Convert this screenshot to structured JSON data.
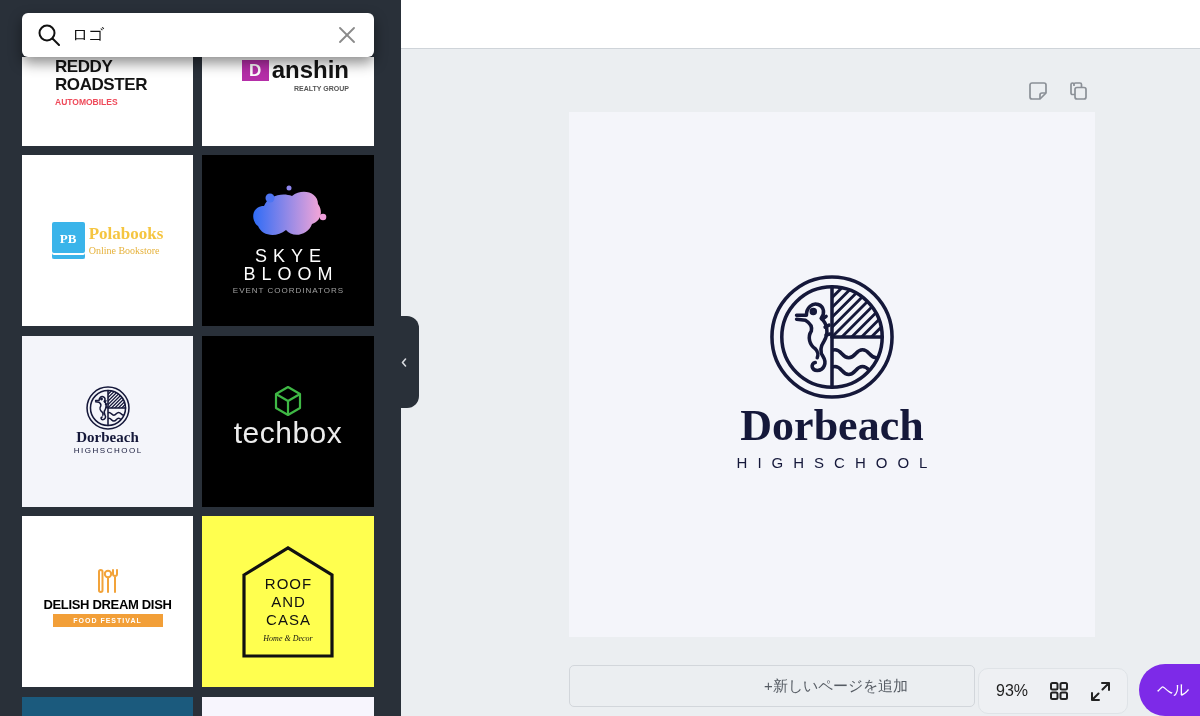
{
  "search": {
    "value": "ロゴ"
  },
  "templates": [
    {
      "kind": "reddy",
      "texts": [
        "REDDY",
        "ROADSTER",
        "AUTOMOBILES"
      ]
    },
    {
      "kind": "danshin",
      "texts": [
        "D",
        "anshin",
        "REALTY GROUP"
      ]
    },
    {
      "kind": "polabooks",
      "texts": [
        "PB",
        "Polabooks",
        "Online Bookstore"
      ]
    },
    {
      "kind": "skye",
      "texts": [
        "SKYE",
        "BLOOM",
        "EVENT COORDINATORS"
      ]
    },
    {
      "kind": "dorbeach",
      "texts": [
        "Dorbeach",
        "HIGHSCHOOL"
      ]
    },
    {
      "kind": "techbox",
      "texts": [
        "techbox"
      ]
    },
    {
      "kind": "delish",
      "texts": [
        "DELISH DREAM DISH",
        "FOOD FESTIVAL"
      ]
    },
    {
      "kind": "roof",
      "texts": [
        "ROOF",
        "AND",
        "CASA",
        "Home & Decor"
      ]
    },
    {
      "kind": "blank",
      "color": "#1b5a7d"
    },
    {
      "kind": "blank",
      "color": "#f7f5fd"
    }
  ],
  "page": {
    "title": "Dorbeach",
    "subtitle": "HIGHSCHOOL"
  },
  "add_page_button": "+新しいページを追加",
  "zoom_level": "93%",
  "help_button": "ヘル"
}
